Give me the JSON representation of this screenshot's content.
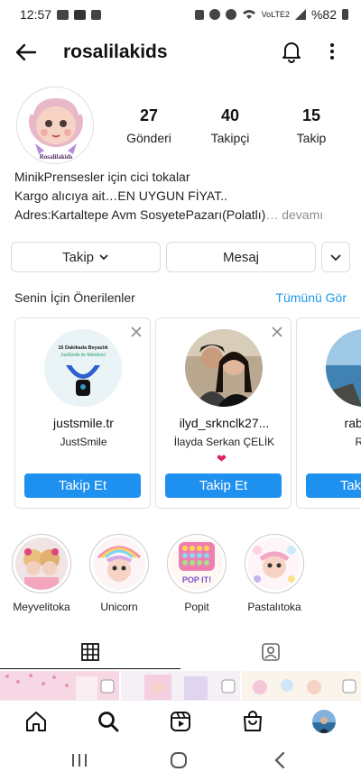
{
  "status": {
    "time": "12:57",
    "network": "VoLTE2",
    "battery": "%82"
  },
  "profile": {
    "username": "rosalilakids",
    "avatar_caption": "Rosalilakids",
    "stats": [
      {
        "value": "27",
        "label": "Gönderi"
      },
      {
        "value": "40",
        "label": "Takipçi"
      },
      {
        "value": "15",
        "label": "Takip"
      }
    ],
    "bio_lines": [
      "MinikPrensesler için cici tokalar",
      "Kargo alıcıya ait…EN UYGUN FİYAT..",
      "Adres:Kartaltepe Avm SosyetePazarı(Polatlı)"
    ],
    "bio_more": "… devamı"
  },
  "buttons": {
    "follow": "Takip",
    "message": "Mesaj"
  },
  "suggestions": {
    "title": "Senin İçin Önerilenler",
    "see_all": "Tümünü Gör",
    "follow_label": "Takip Et",
    "cards": [
      {
        "username": "justsmile.tr",
        "name": "JustSmile",
        "pic_text_1": "16 Dakikada Beyazlık",
        "pic_text_2": "JustSmile ile Mümkün!"
      },
      {
        "username": "ilyd_srknclk27...",
        "name": "İlayda Serkan ÇELİK",
        "heart": "❤"
      },
      {
        "username": "rabia_k",
        "name": "Rab"
      }
    ]
  },
  "highlights": [
    {
      "label": "Meyvelitoka"
    },
    {
      "label": "Unicorn"
    },
    {
      "label": "Popit",
      "badge": "POP IT!"
    },
    {
      "label": "Pastalıtoka"
    }
  ],
  "colors": {
    "accent": "#1e90f0",
    "link": "#1e9ae8",
    "text": "#262626"
  },
  "icons": [
    "back-arrow-icon",
    "bell-icon",
    "more-icon",
    "chevron-down-icon",
    "close-icon",
    "grid-icon",
    "tagged-icon",
    "home-icon",
    "search-icon",
    "reels-icon",
    "shop-icon"
  ]
}
